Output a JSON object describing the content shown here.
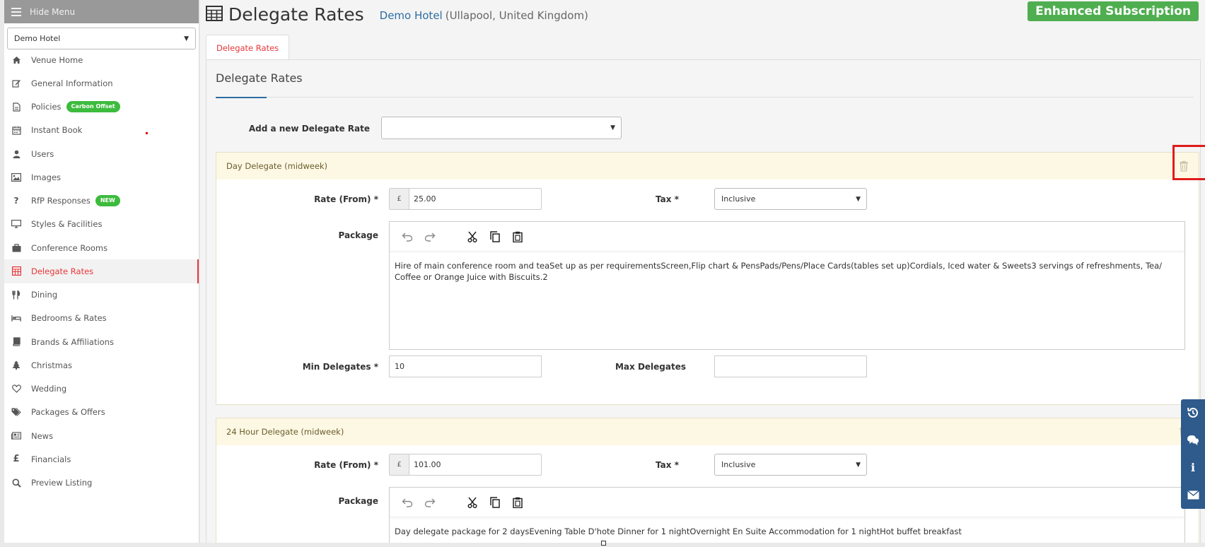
{
  "sidebar": {
    "hide_menu": "Hide Menu",
    "venue_select": "Demo Hotel",
    "items": [
      {
        "label": "Venue Home",
        "icon": "home-icon"
      },
      {
        "label": "General Information",
        "icon": "edit-icon"
      },
      {
        "label": "Policies",
        "icon": "document-icon",
        "badge": "Carbon Offset"
      },
      {
        "label": "Instant Book",
        "icon": "calendar-icon"
      },
      {
        "label": "Users",
        "icon": "user-icon"
      },
      {
        "label": "Images",
        "icon": "image-icon"
      },
      {
        "label": "RfP Responses",
        "icon": "question-icon",
        "badge": "NEW"
      },
      {
        "label": "Styles & Facilities",
        "icon": "monitor-icon"
      },
      {
        "label": "Conference Rooms",
        "icon": "briefcase-icon"
      },
      {
        "label": "Delegate Rates",
        "icon": "table-icon",
        "active": true
      },
      {
        "label": "Dining",
        "icon": "cutlery-icon"
      },
      {
        "label": "Bedrooms & Rates",
        "icon": "bed-icon"
      },
      {
        "label": "Brands & Affiliations",
        "icon": "book-icon"
      },
      {
        "label": "Christmas",
        "icon": "tree-icon"
      },
      {
        "label": "Wedding",
        "icon": "heart-icon"
      },
      {
        "label": "Packages & Offers",
        "icon": "tags-icon"
      },
      {
        "label": "News",
        "icon": "newspaper-icon"
      },
      {
        "label": "Financials",
        "icon": "pound-icon"
      },
      {
        "label": "Preview Listing",
        "icon": "search-icon"
      }
    ]
  },
  "header": {
    "title": "Delegate Rates",
    "hotel_name": "Demo Hotel",
    "hotel_location": "(Ullapool, United Kingdom)",
    "subscription": "Enhanced Subscription"
  },
  "tabs": [
    {
      "label": "Delegate Rates"
    }
  ],
  "main": {
    "section_title": "Delegate Rates",
    "add_label": "Add a new Delegate Rate",
    "add_value": ""
  },
  "panels": [
    {
      "title": "Day Delegate (midweek)",
      "rate_label": "Rate (From)",
      "currency": "£",
      "rate": "25.00",
      "tax_label": "Tax",
      "tax": "Inclusive",
      "package_label": "Package",
      "package_text": "Hire of main conference room and teaSet up as per requirementsScreen,Flip chart & PensPads/Pens/Place Cards(tables set up)Cordials, Iced water & Sweets3 servings of refreshments, Tea/ Coffee or Orange Juice with Biscuits.2",
      "min_label": "Min Delegates",
      "min": "10",
      "max_label": "Max Delegates",
      "max": ""
    },
    {
      "title": "24 Hour Delegate (midweek)",
      "rate_label": "Rate (From)",
      "currency": "£",
      "rate": "101.00",
      "tax_label": "Tax",
      "tax": "Inclusive",
      "package_label": "Package",
      "package_text": "Day delegate package for 2 daysEvening Table D'hote Dinner for 1 nightOvernight En Suite Accommodation for 1 nightHot buffet breakfast"
    }
  ],
  "required_mark": "*",
  "colors": {
    "accent": "#e8363a",
    "link": "#2d6ca2",
    "subscription": "#4fae4f",
    "badge": "#3dbb3d",
    "panel_head": "#fdf8e4",
    "float_bar": "#2e5a8c",
    "highlight": "#e01b1b"
  }
}
